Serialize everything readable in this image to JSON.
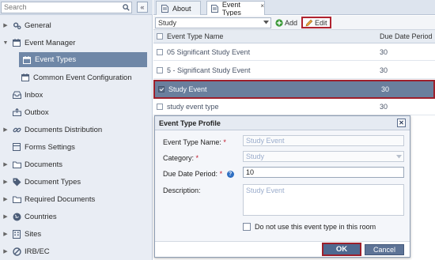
{
  "search": {
    "placeholder": "Search",
    "value": ""
  },
  "sidebar": {
    "items": [
      {
        "label": "General",
        "icon": "gears-icon",
        "expandable": true
      },
      {
        "label": "Event Manager",
        "icon": "calendar-icon",
        "expandable": true,
        "expanded": true
      },
      {
        "label": "Event Types",
        "icon": "calendar-icon",
        "selected": true
      },
      {
        "label": "Common Event Configuration",
        "icon": "calendar-icon"
      },
      {
        "label": "Inbox",
        "icon": "inbox-icon"
      },
      {
        "label": "Outbox",
        "icon": "outbox-icon"
      },
      {
        "label": "Documents Distribution",
        "icon": "link-icon",
        "expandable": true
      },
      {
        "label": "Forms Settings",
        "icon": "form-icon"
      },
      {
        "label": "Documents",
        "icon": "folder-icon",
        "expandable": true
      },
      {
        "label": "Document Types",
        "icon": "tag-icon",
        "expandable": true
      },
      {
        "label": "Required Documents",
        "icon": "folder-icon",
        "expandable": true
      },
      {
        "label": "Countries",
        "icon": "globe-icon",
        "expandable": true
      },
      {
        "label": "Sites",
        "icon": "building-icon",
        "expandable": true
      },
      {
        "label": "IRB/EC",
        "icon": "ban-icon",
        "expandable": true
      }
    ]
  },
  "tabs": [
    {
      "label": "About",
      "icon": "document-icon",
      "active": false,
      "closable": false
    },
    {
      "label": "Event Types",
      "icon": "document-icon",
      "active": true,
      "closable": true,
      "close": "×"
    }
  ],
  "toolbar": {
    "category": "Study",
    "add_label": "Add",
    "edit_label": "Edit"
  },
  "grid": {
    "columns": [
      "Event Type Name",
      "Due Date Period"
    ],
    "rows": [
      {
        "name": "05 Significant Study Event",
        "due": "30",
        "selected": false
      },
      {
        "name": "5 - Significant Study Event",
        "due": "30",
        "selected": false
      },
      {
        "name": "Study Event",
        "due": "30",
        "selected": true
      },
      {
        "name": "study event type",
        "due": "30",
        "selected": false
      }
    ]
  },
  "dialog": {
    "title": "Event Type Profile",
    "close": "✕",
    "fields": {
      "name_label": "Event Type Name:",
      "name_value": "Study Event",
      "category_label": "Category:",
      "category_value": "Study",
      "due_label": "Due Date Period:",
      "due_value": "10",
      "help": "?",
      "desc_label": "Description:",
      "desc_value": "Study Event",
      "required_mark": "*"
    },
    "checkbox_label": "Do not use this event type in this room",
    "ok_label": "OK",
    "cancel_label": "Cancel"
  },
  "colors": {
    "selected_bg": "#6f87a7",
    "highlight_border": "#9d1f2b",
    "button_bg": "#4f6990",
    "required": "#c0182a"
  }
}
